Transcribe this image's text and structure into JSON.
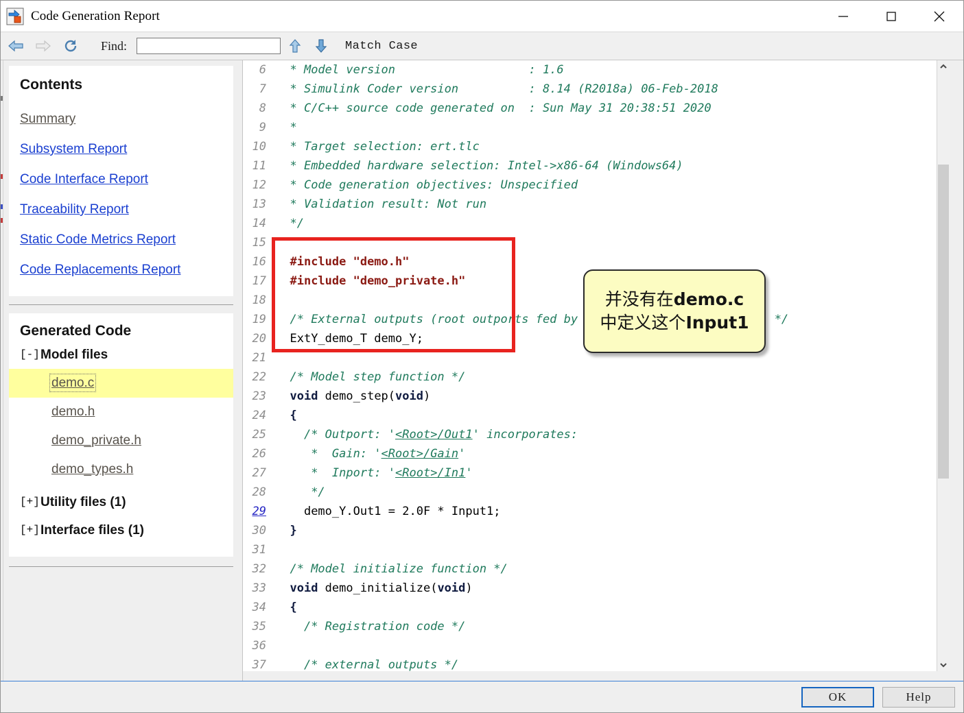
{
  "window": {
    "title": "Code Generation Report",
    "icon": "simulink-model-icon",
    "controls": {
      "minimize": "minimize-icon",
      "maximize": "maximize-icon",
      "close": "close-icon"
    }
  },
  "toolbar": {
    "back": "back-arrow-icon",
    "forward": "forward-arrow-icon",
    "reload": "reload-icon",
    "find_label": "Find:",
    "find_value": "",
    "find_placeholder": "",
    "find_prev": "up-arrow-icon",
    "find_next": "down-arrow-icon",
    "match_case": "Match Case"
  },
  "sidebar": {
    "contents": {
      "title": "Contents",
      "links": [
        {
          "label": "Summary",
          "state": "visited"
        },
        {
          "label": "Subsystem Report",
          "state": "normal"
        },
        {
          "label": "Code Interface Report",
          "state": "normal"
        },
        {
          "label": "Traceability Report",
          "state": "normal"
        },
        {
          "label": "Static Code Metrics Report",
          "state": "normal"
        },
        {
          "label": "Code Replacements Report",
          "state": "normal"
        }
      ]
    },
    "generated": {
      "title": "Generated Code",
      "groups": [
        {
          "toggle": "[-]",
          "label": "Model files",
          "expanded": true,
          "files": [
            {
              "name": "demo.c",
              "selected": true
            },
            {
              "name": "demo.h",
              "selected": false
            },
            {
              "name": "demo_private.h",
              "selected": false
            },
            {
              "name": "demo_types.h",
              "selected": false
            }
          ]
        },
        {
          "toggle": "[+]",
          "label": "Utility files (1)",
          "expanded": false,
          "files": []
        },
        {
          "toggle": "[+]",
          "label": "Interface files (1)",
          "expanded": false,
          "files": []
        }
      ]
    }
  },
  "code": {
    "file": "demo.c",
    "first_line": 6,
    "lines": [
      {
        "n": "6",
        "link": false,
        "tokens": [
          {
            "t": "  ",
            "c": "src"
          },
          {
            "t": "* Model version                   : 1.6",
            "c": "cmt"
          }
        ]
      },
      {
        "n": "7",
        "link": false,
        "tokens": [
          {
            "t": "  ",
            "c": "src"
          },
          {
            "t": "* Simulink Coder version          : 8.14 (R2018a) 06-Feb-2018",
            "c": "cmt"
          }
        ]
      },
      {
        "n": "8",
        "link": false,
        "tokens": [
          {
            "t": "  ",
            "c": "src"
          },
          {
            "t": "* C/C++ source code generated on  : Sun May 31 20:38:51 2020",
            "c": "cmt"
          }
        ]
      },
      {
        "n": "9",
        "link": false,
        "tokens": [
          {
            "t": "  ",
            "c": "src"
          },
          {
            "t": "*",
            "c": "cmt"
          }
        ]
      },
      {
        "n": "10",
        "link": false,
        "tokens": [
          {
            "t": "  ",
            "c": "src"
          },
          {
            "t": "* Target selection: ert.tlc",
            "c": "cmt"
          }
        ]
      },
      {
        "n": "11",
        "link": false,
        "tokens": [
          {
            "t": "  ",
            "c": "src"
          },
          {
            "t": "* Embedded hardware selection: Intel->x86-64 (Windows64)",
            "c": "cmt"
          }
        ]
      },
      {
        "n": "12",
        "link": false,
        "tokens": [
          {
            "t": "  ",
            "c": "src"
          },
          {
            "t": "* Code generation objectives: Unspecified",
            "c": "cmt"
          }
        ]
      },
      {
        "n": "13",
        "link": false,
        "tokens": [
          {
            "t": "  ",
            "c": "src"
          },
          {
            "t": "* Validation result: Not run",
            "c": "cmt"
          }
        ]
      },
      {
        "n": "14",
        "link": false,
        "tokens": [
          {
            "t": "  ",
            "c": "src"
          },
          {
            "t": "*/",
            "c": "cmt"
          }
        ]
      },
      {
        "n": "15",
        "link": false,
        "tokens": []
      },
      {
        "n": "16",
        "link": false,
        "tokens": [
          {
            "t": "  ",
            "c": "src"
          },
          {
            "t": "#include \"demo.h\"",
            "c": "pp"
          }
        ]
      },
      {
        "n": "17",
        "link": false,
        "tokens": [
          {
            "t": "  ",
            "c": "src"
          },
          {
            "t": "#include \"demo_private.h\"",
            "c": "pp"
          }
        ]
      },
      {
        "n": "18",
        "link": false,
        "tokens": []
      },
      {
        "n": "19",
        "link": false,
        "tokens": [
          {
            "t": "  ",
            "c": "src"
          },
          {
            "t": "/* External outputs (root outports fed by signals with auto storage) */",
            "c": "cmt"
          }
        ]
      },
      {
        "n": "20",
        "link": false,
        "tokens": [
          {
            "t": "  ",
            "c": "src"
          },
          {
            "t": "ExtY_demo_T demo_Y;",
            "c": "src"
          }
        ]
      },
      {
        "n": "21",
        "link": false,
        "tokens": []
      },
      {
        "n": "22",
        "link": false,
        "tokens": [
          {
            "t": "  ",
            "c": "src"
          },
          {
            "t": "/* Model step function */",
            "c": "cmt"
          }
        ]
      },
      {
        "n": "23",
        "link": false,
        "tokens": [
          {
            "t": "  ",
            "c": "src"
          },
          {
            "t": "void",
            "c": "kw"
          },
          {
            "t": " demo_step(",
            "c": "src"
          },
          {
            "t": "void",
            "c": "kw"
          },
          {
            "t": ")",
            "c": "src"
          }
        ]
      },
      {
        "n": "24",
        "link": false,
        "tokens": [
          {
            "t": "  ",
            "c": "src"
          },
          {
            "t": "{",
            "c": "kw"
          }
        ]
      },
      {
        "n": "25",
        "link": false,
        "tokens": [
          {
            "t": "    ",
            "c": "src"
          },
          {
            "t": "/* Outport: '",
            "c": "cmt"
          },
          {
            "t": "<Root>/Out1",
            "c": "lnk"
          },
          {
            "t": "' incorporates:",
            "c": "cmt"
          }
        ]
      },
      {
        "n": "26",
        "link": false,
        "tokens": [
          {
            "t": "     ",
            "c": "src"
          },
          {
            "t": "*  Gain: '",
            "c": "cmt"
          },
          {
            "t": "<Root>/Gain",
            "c": "lnk"
          },
          {
            "t": "'",
            "c": "cmt"
          }
        ]
      },
      {
        "n": "27",
        "link": false,
        "tokens": [
          {
            "t": "     ",
            "c": "src"
          },
          {
            "t": "*  Inport: '",
            "c": "cmt"
          },
          {
            "t": "<Root>/In1",
            "c": "lnk"
          },
          {
            "t": "'",
            "c": "cmt"
          }
        ]
      },
      {
        "n": "28",
        "link": false,
        "tokens": [
          {
            "t": "     ",
            "c": "src"
          },
          {
            "t": "*/",
            "c": "cmt"
          }
        ]
      },
      {
        "n": "29",
        "link": true,
        "tokens": [
          {
            "t": "    ",
            "c": "src"
          },
          {
            "t": "demo_Y.Out1 = 2.0F * Input1;",
            "c": "src"
          }
        ]
      },
      {
        "n": "30",
        "link": false,
        "tokens": [
          {
            "t": "  ",
            "c": "src"
          },
          {
            "t": "}",
            "c": "kw"
          }
        ]
      },
      {
        "n": "31",
        "link": false,
        "tokens": []
      },
      {
        "n": "32",
        "link": false,
        "tokens": [
          {
            "t": "  ",
            "c": "src"
          },
          {
            "t": "/* Model initialize function */",
            "c": "cmt"
          }
        ]
      },
      {
        "n": "33",
        "link": false,
        "tokens": [
          {
            "t": "  ",
            "c": "src"
          },
          {
            "t": "void",
            "c": "kw"
          },
          {
            "t": " demo_initialize(",
            "c": "src"
          },
          {
            "t": "void",
            "c": "kw"
          },
          {
            "t": ")",
            "c": "src"
          }
        ]
      },
      {
        "n": "34",
        "link": false,
        "tokens": [
          {
            "t": "  ",
            "c": "src"
          },
          {
            "t": "{",
            "c": "kw"
          }
        ]
      },
      {
        "n": "35",
        "link": false,
        "tokens": [
          {
            "t": "    ",
            "c": "src"
          },
          {
            "t": "/* Registration code */",
            "c": "cmt"
          }
        ]
      },
      {
        "n": "36",
        "link": false,
        "tokens": []
      },
      {
        "n": "37",
        "link": false,
        "tokens": [
          {
            "t": "    ",
            "c": "src"
          },
          {
            "t": "/* external outputs */",
            "c": "cmt"
          }
        ]
      }
    ]
  },
  "annotations": {
    "highlight_box": {
      "color": "#e8231f",
      "label": "include-and-extern-outputs-highlight"
    },
    "note": {
      "lines": [
        {
          "plain": "并没有在",
          "bold": "demo.c"
        },
        {
          "plain": "中定义这个",
          "bold": "Input1"
        }
      ],
      "background": "#fcfcc2",
      "border": "#2a2a2a"
    }
  },
  "scrollbar": {
    "up": "scroll-up-icon",
    "down": "scroll-down-icon"
  },
  "footer": {
    "ok": "OK",
    "help": "Help"
  }
}
